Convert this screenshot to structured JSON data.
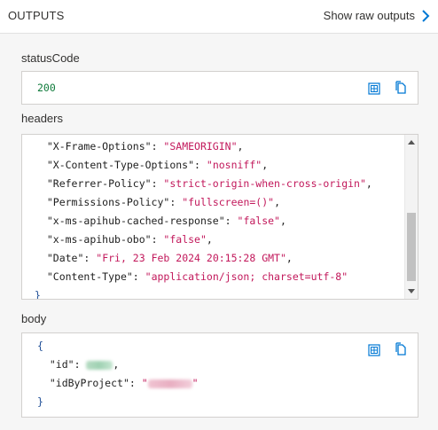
{
  "header": {
    "title": "OUTPUTS",
    "raw_link": "Show raw outputs"
  },
  "status_code": {
    "label": "statusCode",
    "value": "200"
  },
  "headers_section": {
    "label": "headers",
    "lines": [
      {
        "key": "\"X-Frame-Options\"",
        "sep": ": ",
        "value": "\"SAMEORIGIN\"",
        "end": ","
      },
      {
        "key": "\"X-Content-Type-Options\"",
        "sep": ": ",
        "value": "\"nosniff\"",
        "end": ","
      },
      {
        "key": "\"Referrer-Policy\"",
        "sep": ": ",
        "value": "\"strict-origin-when-cross-origin\"",
        "end": ","
      },
      {
        "key": "\"Permissions-Policy\"",
        "sep": ": ",
        "value": "\"fullscreen=()\"",
        "end": ","
      },
      {
        "key": "\"x-ms-apihub-cached-response\"",
        "sep": ": ",
        "value": "\"false\"",
        "end": ","
      },
      {
        "key": "\"x-ms-apihub-obo\"",
        "sep": ": ",
        "value": "\"false\"",
        "end": ","
      },
      {
        "key": "\"Date\"",
        "sep": ": ",
        "value": "\"Fri, 23 Feb 2024 20:15:28 GMT\"",
        "end": ","
      },
      {
        "key": "\"Content-Type\"",
        "sep": ": ",
        "value": "\"application/json; charset=utf-8\"",
        "end": ""
      }
    ],
    "closing_brace": "}"
  },
  "body_section": {
    "label": "body",
    "open_brace": "{",
    "id_key": "\"id\"",
    "id_sep": ": ",
    "id_end": ",",
    "id_by_project_key": "\"idByProject\"",
    "id_by_project_sep": ": ",
    "quote_open": "\"",
    "quote_close": "\"",
    "close_brace": "}"
  },
  "icons": {
    "table_view": "table-view-icon",
    "copy": "copy-icon",
    "chevron": "chevron-right-icon"
  },
  "colors": {
    "accent": "#0078d4",
    "string": "#c2185b",
    "number": "#0e7a3a",
    "brace": "#1f4e96"
  }
}
